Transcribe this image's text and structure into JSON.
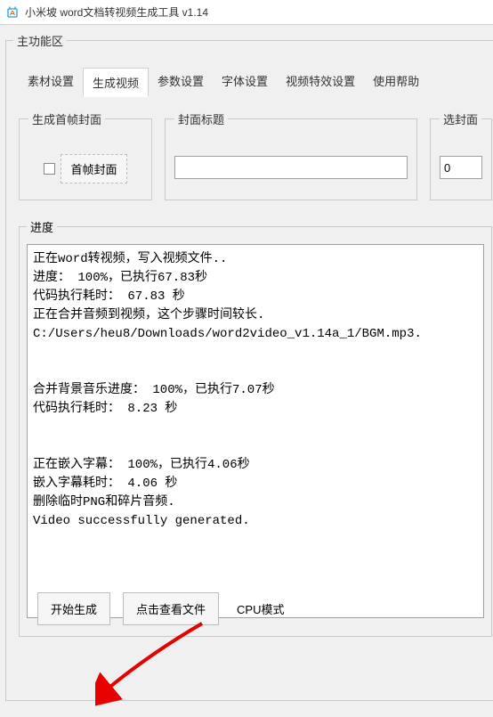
{
  "window": {
    "title": "小米坡 word文档转视频生成工具 v1.14",
    "icon": "app-icon"
  },
  "main_legend": "主功能区",
  "tabs": [
    {
      "label": "素材设置",
      "active": false
    },
    {
      "label": "生成视频",
      "active": true
    },
    {
      "label": "参数设置",
      "active": false
    },
    {
      "label": "字体设置",
      "active": false
    },
    {
      "label": "视频特效设置",
      "active": false
    },
    {
      "label": "使用帮助",
      "active": false
    }
  ],
  "cover_group": {
    "legend": "生成首帧封面",
    "checkbox_checked": false,
    "button_label": "首帧封面"
  },
  "title_group": {
    "legend": "封面标题",
    "value": ""
  },
  "select_group": {
    "legend": "选封面",
    "value": "0"
  },
  "progress_group": {
    "legend": "进度",
    "log_lines": [
      "正在word转视频，写入视频文件..",
      "进度： 100%，已执行67.83秒",
      "代码执行耗时： 67.83 秒",
      "正在合并音频到视频，这个步骤时间较长.",
      "C:/Users/heu8/Downloads/word2video_v1.14a_1/BGM.mp3.",
      "",
      "",
      "合并背景音乐进度： 100%，已执行7.07秒",
      "代码执行耗时： 8.23 秒",
      "",
      "",
      "正在嵌入字幕： 100%，已执行4.06秒",
      "嵌入字幕耗时： 4.06 秒",
      "删除临时PNG和碎片音频.",
      "Video successfully generated."
    ]
  },
  "bottom": {
    "start_label": "开始生成",
    "view_label": "点击查看文件",
    "cpu_label": "CPU模式"
  },
  "annotation": {
    "arrow_color": "#e60000"
  }
}
